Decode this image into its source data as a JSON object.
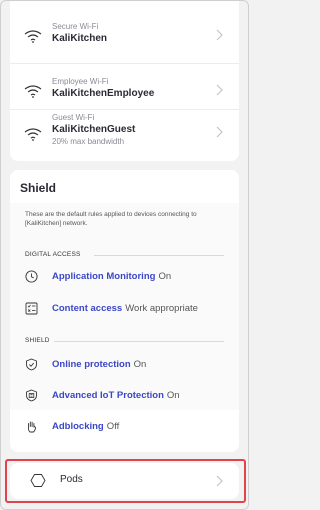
{
  "wifi_networks": [
    {
      "subtitle": "Secure Wi-Fi",
      "name": "KaliKitchen",
      "extra": ""
    },
    {
      "subtitle": "Employee Wi-Fi",
      "name": "KaliKitchenEmployee",
      "extra": ""
    },
    {
      "subtitle": "Guest Wi-Fi",
      "name": "KaliKitchenGuest",
      "extra": "20% max bandwidth"
    }
  ],
  "shield": {
    "title": "Shield",
    "description": "These are the default rules applied to devices connecting to [KaliKitchen] network.",
    "digital_access_heading": "DIGITAL ACCESS",
    "shield_heading": "SHIELD",
    "digital_access": [
      {
        "label": "Application Monitoring",
        "value": "On",
        "icon": "clock-icon"
      },
      {
        "label": "Content access",
        "value": "Work appropriate",
        "icon": "filter-list-icon"
      }
    ],
    "shield_rules": [
      {
        "label": "Online protection",
        "value": "On",
        "icon": "shield-check-icon"
      },
      {
        "label": "Advanced IoT Protection",
        "value": "On",
        "icon": "iot-shield-icon"
      },
      {
        "label": "Adblocking",
        "value": "Off",
        "icon": "hand-stop-icon"
      }
    ]
  },
  "pods": {
    "label": "Pods",
    "icon": "hexagon-icon"
  },
  "colors": {
    "accent": "#3b47c6",
    "highlight": "#e0444a",
    "background": "#f2f2f2"
  }
}
